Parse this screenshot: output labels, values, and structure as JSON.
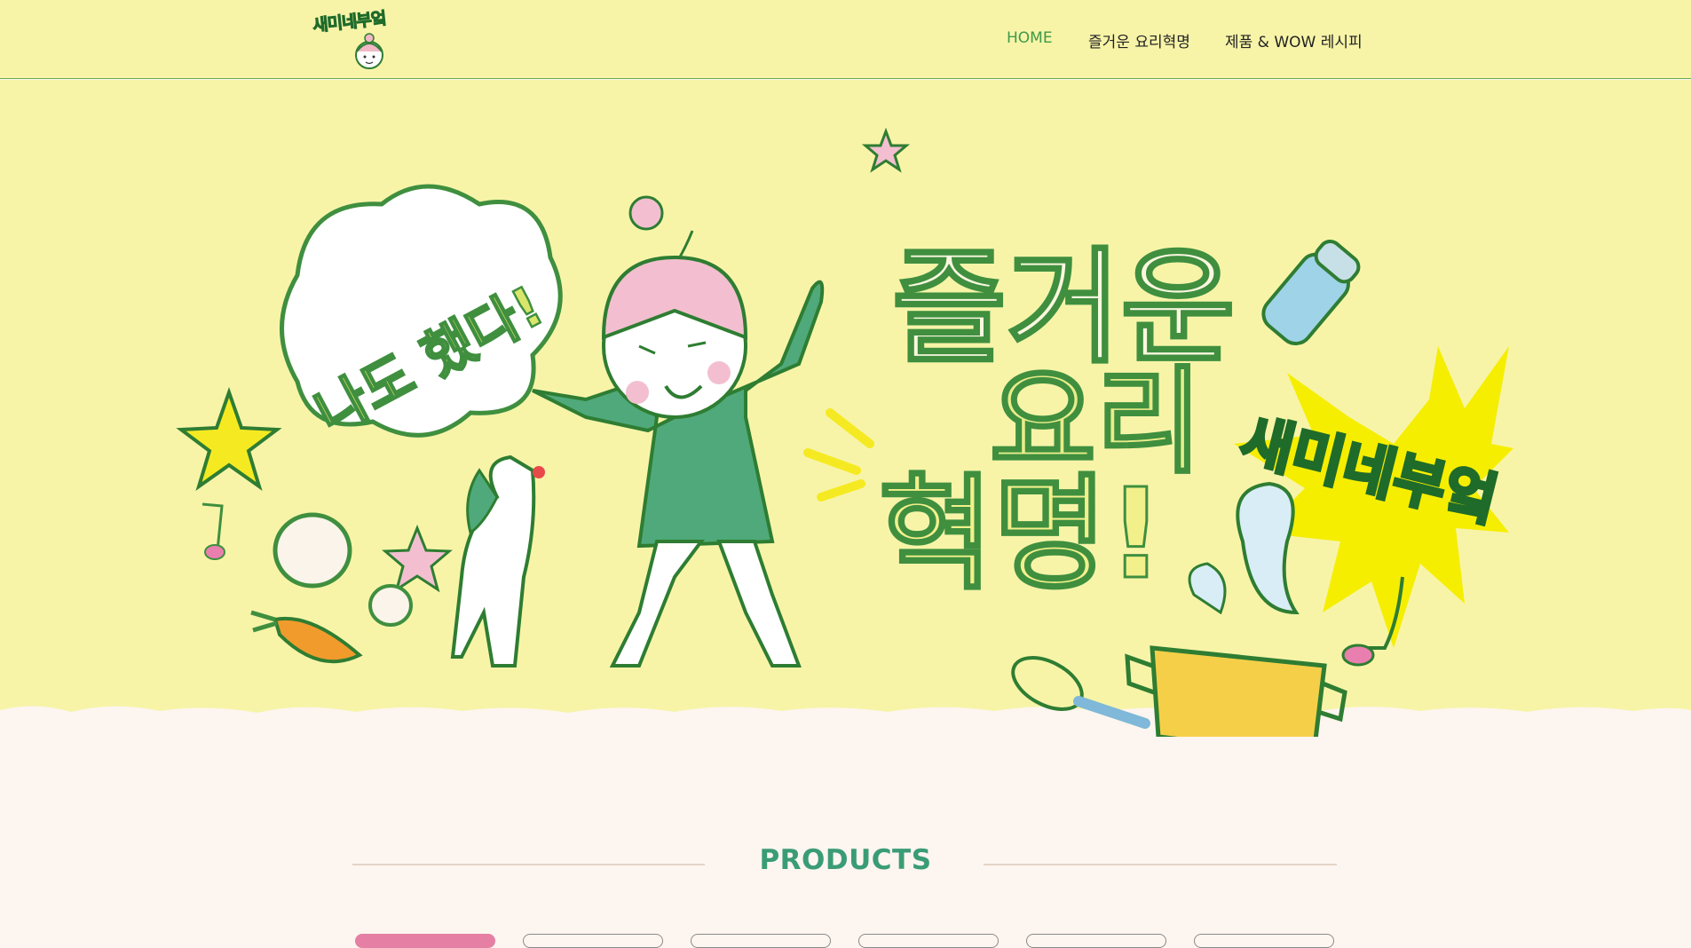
{
  "header": {
    "logo_text": "새미네부엌",
    "nav": [
      {
        "label": "HOME",
        "active": true
      },
      {
        "label": "즐거운 요리혁명",
        "active": false
      },
      {
        "label": "제품 & WOW 레시피",
        "active": false
      }
    ]
  },
  "hero": {
    "speech_bubble": "나도 했다!",
    "headline_line1": "즐거운",
    "headline_line2": "요리",
    "headline_line3": "혁명!",
    "burst_text": "새미네부엌"
  },
  "products": {
    "title": "PRODUCTS",
    "tabs_count": 6,
    "active_tab_index": 0
  },
  "colors": {
    "header_bg": "#f7f4a8",
    "nav_active": "#3f9a49",
    "title_green": "#3a9c76",
    "page_bg": "#fdf5ef",
    "active_tab": "#e57fa4",
    "hero_green": "#4fa97a",
    "burst_yellow": "#f6ee00"
  }
}
